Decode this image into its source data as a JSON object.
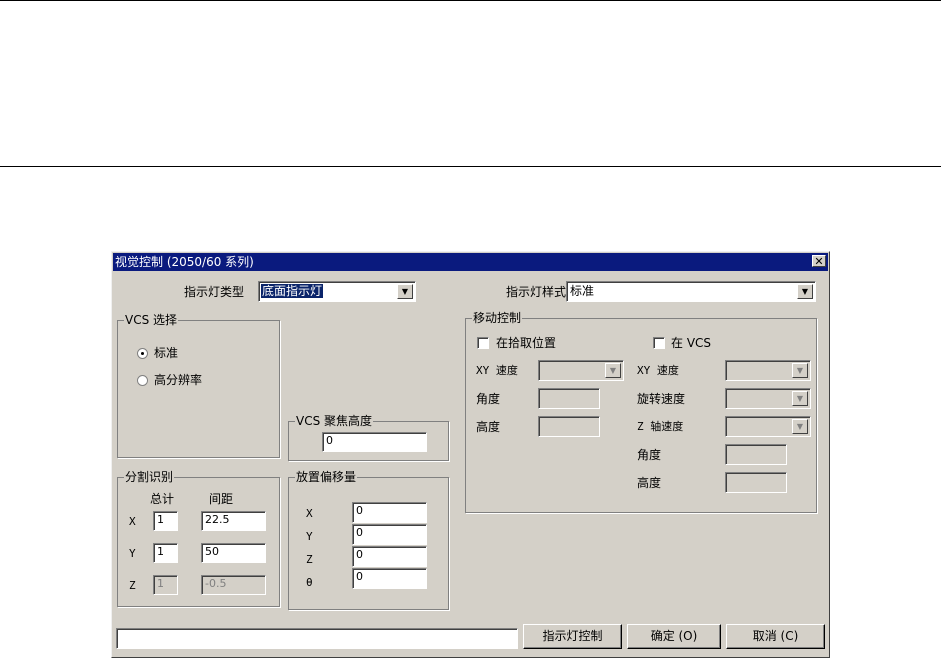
{
  "dialog": {
    "title": "视觉控制 (2050/60 系列)",
    "close_glyph": "✕"
  },
  "top": {
    "light_type_label": "指示灯类型",
    "light_type_value": "底面指示灯",
    "light_style_label": "指示灯样式",
    "light_style_value": "标准"
  },
  "vcs_select": {
    "legend": "VCS 选择",
    "options": [
      "标准",
      "高分辨率"
    ],
    "selected_index": 0
  },
  "vcs_focus": {
    "legend": "VCS 聚焦高度",
    "value": "0"
  },
  "segment": {
    "legend": "分割识别",
    "col_total": "总计",
    "col_spacing": "间距",
    "rows": [
      {
        "axis": "X",
        "total": "1",
        "spacing": "22.5",
        "disabled": false
      },
      {
        "axis": "Y",
        "total": "1",
        "spacing": "50",
        "disabled": false
      },
      {
        "axis": "Z",
        "total": "1",
        "spacing": "-0.5",
        "disabled": true
      }
    ]
  },
  "offset": {
    "legend": "放置偏移量",
    "rows": [
      {
        "axis": "X",
        "value": "0"
      },
      {
        "axis": "Y",
        "value": "0"
      },
      {
        "axis": "Z",
        "value": "0"
      },
      {
        "axis": "θ",
        "value": "0"
      }
    ]
  },
  "move": {
    "legend": "移动控制",
    "left_check": "在拾取位置",
    "right_check": "在 VCS",
    "left_xy_speed": "XY 速度",
    "left_angle": "角度",
    "left_height": "高度",
    "right_xy_speed": "XY 速度",
    "right_rot_speed": "旋转速度",
    "right_z_speed": "Z 轴速度",
    "right_angle": "角度",
    "right_height": "高度"
  },
  "bottom": {
    "status_text": "",
    "light_control_button": "指示灯控制",
    "ok_button": "确定 (O)",
    "cancel_button": "取消 (C)"
  },
  "icons": {
    "dropdown": "▼",
    "close": "close-icon"
  }
}
